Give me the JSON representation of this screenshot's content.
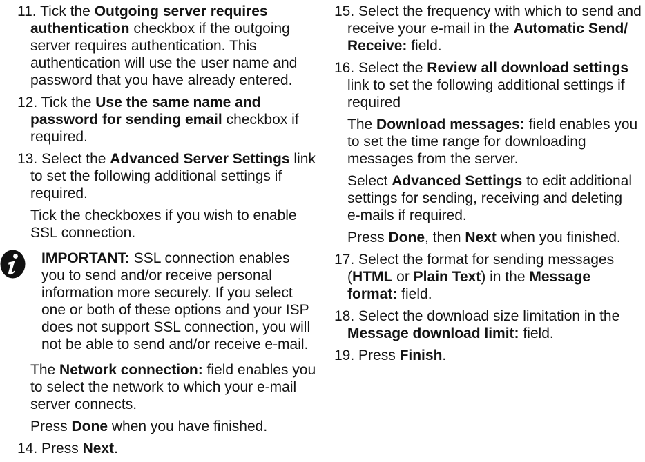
{
  "left_column": {
    "blocks": [
      {
        "kind": "step",
        "number": "11.",
        "lines": [
          [
            {
              "text": "Tick the "
            },
            {
              "text": "Outgoing server requires",
              "bold": true
            }
          ],
          [
            {
              "text": "authentication",
              "bold": true
            },
            {
              "text": " checkbox if the outgoing"
            }
          ],
          [
            {
              "text": "server requires authentication. This"
            }
          ],
          [
            {
              "text": "authentication will use the user name and"
            }
          ],
          [
            {
              "text": "password that you have already entered."
            }
          ]
        ]
      },
      {
        "kind": "step",
        "number": "12.",
        "lines": [
          [
            {
              "text": "Tick the "
            },
            {
              "text": "Use the same name and",
              "bold": true
            }
          ],
          [
            {
              "text": "password for sending email",
              "bold": true
            },
            {
              "text": " checkbox if"
            }
          ],
          [
            {
              "text": "required."
            }
          ]
        ]
      },
      {
        "kind": "step",
        "number": "13.",
        "lines": [
          [
            {
              "text": "Select the "
            },
            {
              "text": "Advanced Server Settings",
              "bold": true
            },
            {
              "text": " link"
            }
          ],
          [
            {
              "text": "to set the following additional settings if"
            }
          ],
          [
            {
              "text": "required."
            }
          ]
        ]
      },
      {
        "kind": "para",
        "lines": [
          [
            {
              "text": "Tick the checkboxes if you wish to enable"
            }
          ],
          [
            {
              "text": "SSL connection."
            }
          ]
        ]
      },
      {
        "kind": "note",
        "icon": "info-icon",
        "lines": [
          [
            {
              "text": "IMPORTANT:",
              "bold": true
            },
            {
              "text": " SSL connection enables"
            }
          ],
          [
            {
              "text": "you to send and/or receive personal"
            }
          ],
          [
            {
              "text": "information more securely. If you select"
            }
          ],
          [
            {
              "text": "one or both of these options and your ISP"
            }
          ],
          [
            {
              "text": "does not support SSL connection, you will"
            }
          ],
          [
            {
              "text": "not be able to send and/or receive e-mail."
            }
          ]
        ]
      },
      {
        "kind": "para",
        "lines": [
          [
            {
              "text": "The "
            },
            {
              "text": "Network connection:",
              "bold": true
            },
            {
              "text": " field enables you"
            }
          ],
          [
            {
              "text": "to select the network to which your e-mail"
            }
          ],
          [
            {
              "text": "server connects."
            }
          ]
        ]
      },
      {
        "kind": "para",
        "lines": [
          [
            {
              "text": "Press "
            },
            {
              "text": "Done",
              "bold": true
            },
            {
              "text": " when you have finished."
            }
          ]
        ]
      },
      {
        "kind": "step",
        "number": "14.",
        "lines": [
          [
            {
              "text": "Press "
            },
            {
              "text": "Next",
              "bold": true
            },
            {
              "text": "."
            }
          ]
        ]
      }
    ]
  },
  "right_column": {
    "blocks": [
      {
        "kind": "step",
        "number": "15.",
        "lines": [
          [
            {
              "text": "Select the frequency with which to send and"
            }
          ],
          [
            {
              "text": "receive your e-mail in the "
            },
            {
              "text": "Automatic Send/",
              "bold": true
            }
          ],
          [
            {
              "text": "Receive:",
              "bold": true
            },
            {
              "text": " field."
            }
          ]
        ]
      },
      {
        "kind": "step",
        "number": "16.",
        "lines": [
          [
            {
              "text": "Select the "
            },
            {
              "text": "Review all download settings",
              "bold": true
            }
          ],
          [
            {
              "text": "link to set the following additional settings if"
            }
          ],
          [
            {
              "text": "required"
            }
          ]
        ]
      },
      {
        "kind": "para",
        "lines": [
          [
            {
              "text": "The "
            },
            {
              "text": "Download messages:",
              "bold": true
            },
            {
              "text": " field enables you"
            }
          ],
          [
            {
              "text": "to set the time range for downloading"
            }
          ],
          [
            {
              "text": "messages from the server."
            }
          ]
        ]
      },
      {
        "kind": "para",
        "lines": [
          [
            {
              "text": "Select "
            },
            {
              "text": "Advanced Settings",
              "bold": true
            },
            {
              "text": " to edit additional"
            }
          ],
          [
            {
              "text": "settings for sending, receiving and deleting"
            }
          ],
          [
            {
              "text": "e-mails if required."
            }
          ]
        ]
      },
      {
        "kind": "para",
        "lines": [
          [
            {
              "text": "Press "
            },
            {
              "text": "Done",
              "bold": true
            },
            {
              "text": ", then "
            },
            {
              "text": "Next",
              "bold": true
            },
            {
              "text": " when you finished."
            }
          ]
        ]
      },
      {
        "kind": "step",
        "number": "17.",
        "lines": [
          [
            {
              "text": "Select the format for sending messages"
            }
          ],
          [
            {
              "text": "("
            },
            {
              "text": "HTML",
              "bold": true
            },
            {
              "text": " or "
            },
            {
              "text": "Plain Text",
              "bold": true
            },
            {
              "text": ") in the "
            },
            {
              "text": "Message",
              "bold": true
            }
          ],
          [
            {
              "text": "format:",
              "bold": true
            },
            {
              "text": " field."
            }
          ]
        ]
      },
      {
        "kind": "step",
        "number": "18.",
        "lines": [
          [
            {
              "text": "Select the download size limitation in the"
            }
          ],
          [
            {
              "text": "Message download limit:",
              "bold": true
            },
            {
              "text": " field."
            }
          ]
        ]
      },
      {
        "kind": "step",
        "number": "19.",
        "lines": [
          [
            {
              "text": "Press "
            },
            {
              "text": "Finish",
              "bold": true
            },
            {
              "text": "."
            }
          ]
        ]
      }
    ]
  }
}
